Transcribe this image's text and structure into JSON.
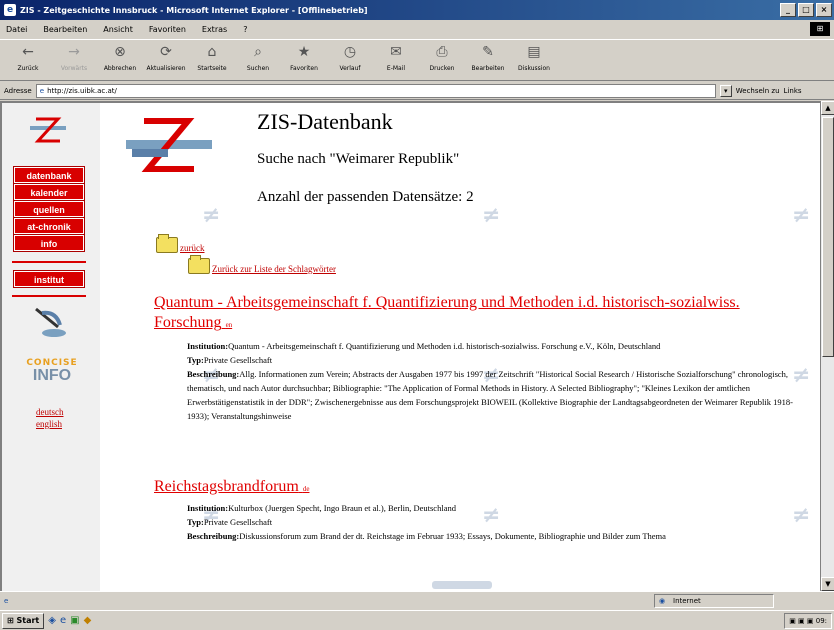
{
  "window": {
    "title": "ZIS - Zeitgeschichte Innsbruck - Microsoft Internet Explorer - [Offlinebetrieb]"
  },
  "menubar": {
    "items": [
      "Datei",
      "Bearbeiten",
      "Ansicht",
      "Favoriten",
      "Extras",
      "?"
    ]
  },
  "toolbar": {
    "buttons": [
      {
        "label": "Zurück",
        "icon": "back-arrow-icon",
        "disabled": false
      },
      {
        "label": "Vorwärts",
        "icon": "forward-arrow-icon",
        "disabled": true
      },
      {
        "label": "Abbrechen",
        "icon": "stop-icon",
        "disabled": false
      },
      {
        "label": "Aktualisieren",
        "icon": "refresh-icon",
        "disabled": false
      },
      {
        "label": "Startseite",
        "icon": "home-icon",
        "disabled": false
      },
      {
        "label": "Suchen",
        "icon": "search-icon",
        "disabled": false
      },
      {
        "label": "Favoriten",
        "icon": "favorites-icon",
        "disabled": false
      },
      {
        "label": "Verlauf",
        "icon": "history-icon",
        "disabled": false
      },
      {
        "label": "E-Mail",
        "icon": "mail-icon",
        "disabled": false
      },
      {
        "label": "Drucken",
        "icon": "print-icon",
        "disabled": false
      },
      {
        "label": "Bearbeiten",
        "icon": "edit-icon",
        "disabled": false
      },
      {
        "label": "Diskussion",
        "icon": "discuss-icon",
        "disabled": false
      }
    ]
  },
  "addressbar": {
    "label": "Adresse",
    "url": "http://zis.uibk.ac.at/",
    "go_label": "Wechseln zu",
    "links_label": "Links"
  },
  "sidebar": {
    "nav_items": [
      "datenbank",
      "kalender",
      "quellen",
      "at-chronik",
      "info"
    ],
    "institut_label": "institut",
    "coninfo_top": "CONCISE",
    "coninfo_bottom": "INFO",
    "lang_de": "deutsch",
    "lang_en": "english"
  },
  "main": {
    "heading": "ZIS-Datenbank",
    "search_line": "Suche nach \"Weimarer Republik\"",
    "count_line": "Anzahl der passenden Datensätze: 2",
    "back_link": "zurück",
    "back_to_keywords": "Zurück zur Liste der Schlagwörter",
    "results": [
      {
        "title": "Quantum - Arbeitsgemeinschaft f. Quantifizierung und Methoden i.d. historisch-sozialwiss. Forschung",
        "tag": "en",
        "institution_label": "Institution:",
        "institution": "Quantum - Arbeitsgemeinschaft f. Quantifizierung und Methoden i.d. historisch-sozialwiss. Forschung e.V., Köln, Deutschland",
        "type_label": "Typ:",
        "type": "Private Gesellschaft",
        "description_label": "Beschreibung:",
        "description": "Allg. Informationen zum Verein; Abstracts der Ausgaben 1977 bis 1997 der Zeitschrift \"Historical Social Research / Historische Sozialforschung\" chronologisch, thematisch, und nach Autor durchsuchbar; Bibliographie: \"The Application of Formal Methods in History. A Selected Bibliography\"; \"Kleines Lexikon der amtlichen Erwerbstätigenstatistik in der DDR\"; Zwischenergebnisse aus dem Forschungsprojekt BIOWEIL (Kollektive Biographie der Landtagsabgeordneten der Weimarer Republik 1918-1933); Veranstaltungshinweise"
      },
      {
        "title": "Reichstagsbrandforum",
        "tag": "de",
        "institution_label": "Institution:",
        "institution": "Kulturbox (Juergen Specht, Ingo Braun et al.), Berlin, Deutschland",
        "type_label": "Typ:",
        "type": "Private Gesellschaft",
        "description_label": "Beschreibung:",
        "description": "Diskussionsforum zum Brand der dt. Reichstage im Februar 1933; Essays, Dokumente, Bibliographie und Bilder zum Thema"
      }
    ]
  },
  "statusbar": {
    "zone": "Internet"
  },
  "taskbar": {
    "start_label": "Start",
    "clock": "09:"
  },
  "colors": {
    "nav_red": "#d80000",
    "link_red": "#e00000",
    "title_blue": "#0a246a"
  }
}
